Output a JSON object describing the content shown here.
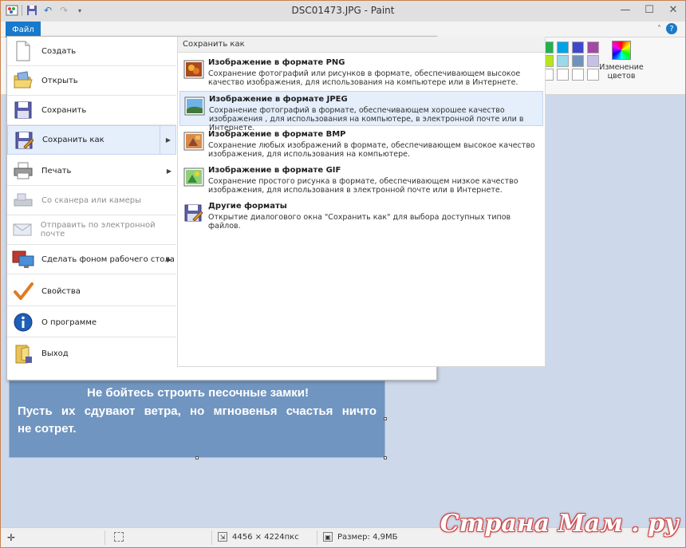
{
  "window": {
    "title": "DSC01473.JPG - Paint",
    "minimize": "—",
    "maximize": "☐",
    "close": "✕"
  },
  "ribbon": {
    "file_tab": "Файл",
    "help": "?",
    "collapse": "˄",
    "edit_colors_label": "Изменение цветов",
    "palette": [
      "#22b14c",
      "#00a2e8",
      "#3f48cc",
      "#a349a4",
      "#b5e61d",
      "#99d9ea",
      "#7092be",
      "#c8bfe7",
      "#ffffff",
      "#ffffff",
      "#ffffff",
      "#ffffff"
    ]
  },
  "file_menu": {
    "items": [
      {
        "label": "Создать",
        "icon": "new-file-icon"
      },
      {
        "label": "Открыть",
        "icon": "open-folder-icon"
      },
      {
        "label": "Сохранить",
        "icon": "save-icon"
      },
      {
        "label": "Сохранить как",
        "icon": "save-as-icon",
        "has_submenu": true,
        "selected": true
      },
      {
        "label": "Печать",
        "icon": "print-icon",
        "has_submenu": true
      },
      {
        "label": "Со сканера или камеры",
        "icon": "scanner-icon",
        "disabled": true
      },
      {
        "label": "Отправить по электронной почте",
        "icon": "email-icon",
        "disabled": true
      },
      {
        "label": "Сделать фоном рабочего стола",
        "icon": "desktop-background-icon",
        "has_submenu": true
      },
      {
        "label": "Свойства",
        "icon": "properties-check-icon"
      },
      {
        "label": "О программе",
        "icon": "info-icon"
      },
      {
        "label": "Выход",
        "icon": "exit-icon"
      }
    ],
    "save_as_pane": {
      "header": "Сохранить как",
      "options": [
        {
          "title": "Изображение в формате PNG",
          "desc": "Сохранение фотографий или рисунков в формате, обеспечивающем высокое качество изображения, для использования на компьютере или в Интернете."
        },
        {
          "title": "Изображение в формате JPEG",
          "desc": "Сохранение фотографий в формате, обеспечивающем хорошее качество изображения , для использования на компьютере, в электронной почте или в Интернете.",
          "selected": true
        },
        {
          "title": "Изображение в формате BMP",
          "desc": "Сохранение любых изображений в формате, обеспечивающем высокое качество изображения, для использования на компьютере."
        },
        {
          "title": "Изображение в формате GIF",
          "desc": "Сохранение простого рисунка в формате, обеспечивающем низкое качество изображения, для использования в электронной почте или в Интернете."
        },
        {
          "title": "Другие форматы",
          "desc": "Открытие диалогового окна \"Сохранить как\" для выбора доступных типов файлов."
        }
      ]
    }
  },
  "canvas": {
    "text_line1": "Не бойтесь строить песочные замки!",
    "text_line2": "Пусть их сдувают ветра, но мгновенья счастья ничто",
    "text_line3": "не сотрет."
  },
  "statusbar": {
    "dimensions": "4456 × 4224пкс",
    "size": "Размер: 4,9МБ"
  },
  "watermark": "Страна Мам . ру"
}
